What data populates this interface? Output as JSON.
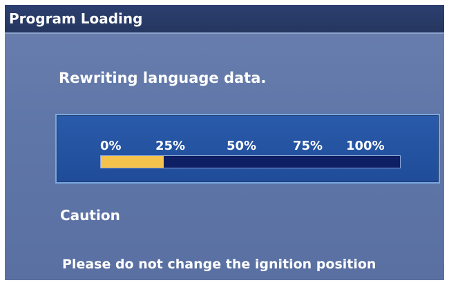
{
  "title_bar": {
    "title": "Program Loading"
  },
  "status": {
    "message": "Rewriting language data."
  },
  "progress": {
    "tick_labels": [
      "0%",
      "25%",
      "50%",
      "75%",
      "100%"
    ],
    "fraction": 0.21
  },
  "caution": {
    "heading": "Caution",
    "message": "Please do not change the ignition position"
  },
  "colors": {
    "progress_fill": "#f5c24e",
    "progress_track": "#0f1f63",
    "panel": "#2352a0",
    "background": "#5f76a8",
    "title_bar": "#2c3f70"
  }
}
